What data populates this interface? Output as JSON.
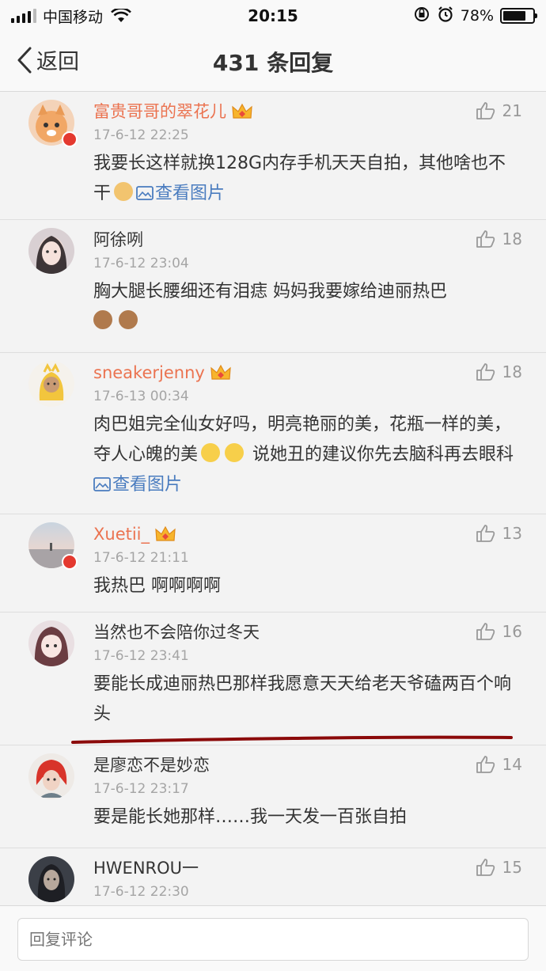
{
  "status_bar": {
    "carrier": "中国移动",
    "time": "20:15",
    "battery": "78%"
  },
  "nav": {
    "back_label": "返回",
    "title": "431 条回复"
  },
  "comments": [
    {
      "user": "富贵哥哥的翠花儿",
      "time": "17-6-12 22:25",
      "likes": "21",
      "text": "我要长这样就换128G内存手机天天自拍，其他啥也不干",
      "pic_link": "查看图片"
    },
    {
      "user": "阿徐咧",
      "time": "17-6-12 23:04",
      "likes": "18",
      "text": "胸大腿长腰细还有泪痣 妈妈我要嫁给迪丽热巴"
    },
    {
      "user": "sneakerjenny",
      "time": "17-6-13 00:34",
      "likes": "18",
      "text": "肉巴姐完全仙女好吗，明亮艳丽的美，花瓶一样的美，夺人心魄的美",
      "text2": " 说她丑的建议你先去脑科再去眼科",
      "pic_link": "查看图片"
    },
    {
      "user": "Xuetii_",
      "time": "17-6-12 21:11",
      "likes": "13",
      "text": "我热巴 啊啊啊啊"
    },
    {
      "user": "当然也不会陪你过冬天",
      "time": "17-6-12 23:41",
      "likes": "16",
      "text": "要能长成迪丽热巴那样我愿意天天给老天爷磕两百个响头"
    },
    {
      "user": "是廖恋不是妙恋",
      "time": "17-6-12 23:17",
      "likes": "14",
      "text": "要是能长她那样……我一天发一百张自拍"
    },
    {
      "user": "HWENROU一",
      "time": "17-6-12 22:30",
      "likes": "15",
      "text": ""
    }
  ],
  "reply_box": {
    "placeholder": "回复评论"
  },
  "colors": {
    "vip_name": "#eb7350",
    "link": "#4a7cbf",
    "underline": "#8b0a0a"
  }
}
